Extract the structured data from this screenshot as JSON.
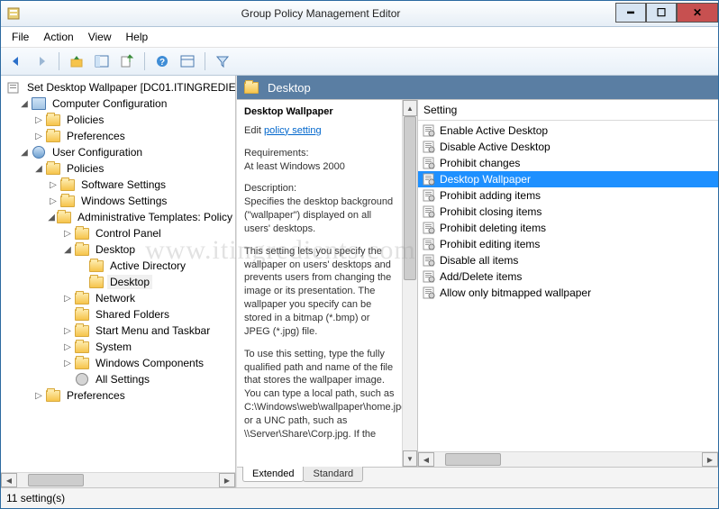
{
  "window": {
    "title": "Group Policy Management Editor"
  },
  "menubar": {
    "items": [
      "File",
      "Action",
      "View",
      "Help"
    ]
  },
  "tree": {
    "root": "Set Desktop Wallpaper [DC01.ITINGREDIENTS",
    "computer_config": "Computer Configuration",
    "cc_policies": "Policies",
    "cc_prefs": "Preferences",
    "user_config": "User Configuration",
    "uc_policies": "Policies",
    "software": "Software Settings",
    "windows": "Windows Settings",
    "admin": "Administrative Templates: Policy",
    "control_panel": "Control Panel",
    "desktop": "Desktop",
    "active_dir": "Active Directory",
    "desktop_sub": "Desktop",
    "network": "Network",
    "shared": "Shared Folders",
    "startmenu": "Start Menu and Taskbar",
    "system": "System",
    "wincomp": "Windows Components",
    "allsettings": "All Settings",
    "uc_prefs": "Preferences"
  },
  "header": {
    "title": "Desktop"
  },
  "description": {
    "title": "Desktop Wallpaper",
    "edit_prefix": "Edit ",
    "edit_link": "policy setting",
    "req_label": "Requirements:",
    "req_text": "At least Windows 2000",
    "desc_label": "Description:",
    "p1": "Specifies the desktop background (\"wallpaper\") displayed on all users' desktops.",
    "p2": "This setting lets you specify the wallpaper on users' desktops and prevents users from changing the image or its presentation. The wallpaper you specify can be stored in a bitmap (*.bmp) or JPEG (*.jpg) file.",
    "p3": "To use this setting, type the fully qualified path and name of the file that stores the wallpaper image. You can type a local path, such as C:\\Windows\\web\\wallpaper\\home.jpg or a UNC path, such as \\\\Server\\Share\\Corp.jpg. If the"
  },
  "settings": {
    "header": "Setting",
    "items": [
      "Enable Active Desktop",
      "Disable Active Desktop",
      "Prohibit changes",
      "Desktop Wallpaper",
      "Prohibit adding items",
      "Prohibit closing items",
      "Prohibit deleting items",
      "Prohibit editing items",
      "Disable all items",
      "Add/Delete items",
      "Allow only bitmapped wallpaper"
    ],
    "selected_index": 3
  },
  "tabs": {
    "extended": "Extended",
    "standard": "Standard"
  },
  "status": {
    "text": "11 setting(s)"
  },
  "watermark": "www.itingredients.com"
}
